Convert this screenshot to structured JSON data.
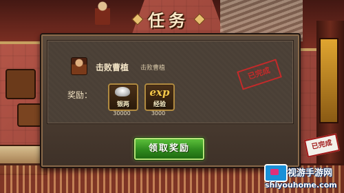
{
  "screen": {
    "title": "任务"
  },
  "quest": {
    "name": "击败曹植",
    "description": "击败曹植",
    "status_stamp": "已完成"
  },
  "rewards": {
    "label": "奖励：",
    "items": [
      {
        "name": "银两",
        "icon": "silver-ingot-icon",
        "amount": "30000"
      },
      {
        "name": "经验",
        "icon": "exp-icon",
        "icon_text": "exp",
        "amount": "3000"
      }
    ]
  },
  "claim_button": {
    "label": "领取奖励"
  },
  "background": {
    "badge_text": "已完成"
  },
  "watermark": {
    "name": "视游手游网",
    "url": "shiyouhome.com"
  },
  "colors": {
    "accent_green": "#3a9a24",
    "stamp_red": "#c42a2a",
    "gold": "#f3c84a"
  }
}
